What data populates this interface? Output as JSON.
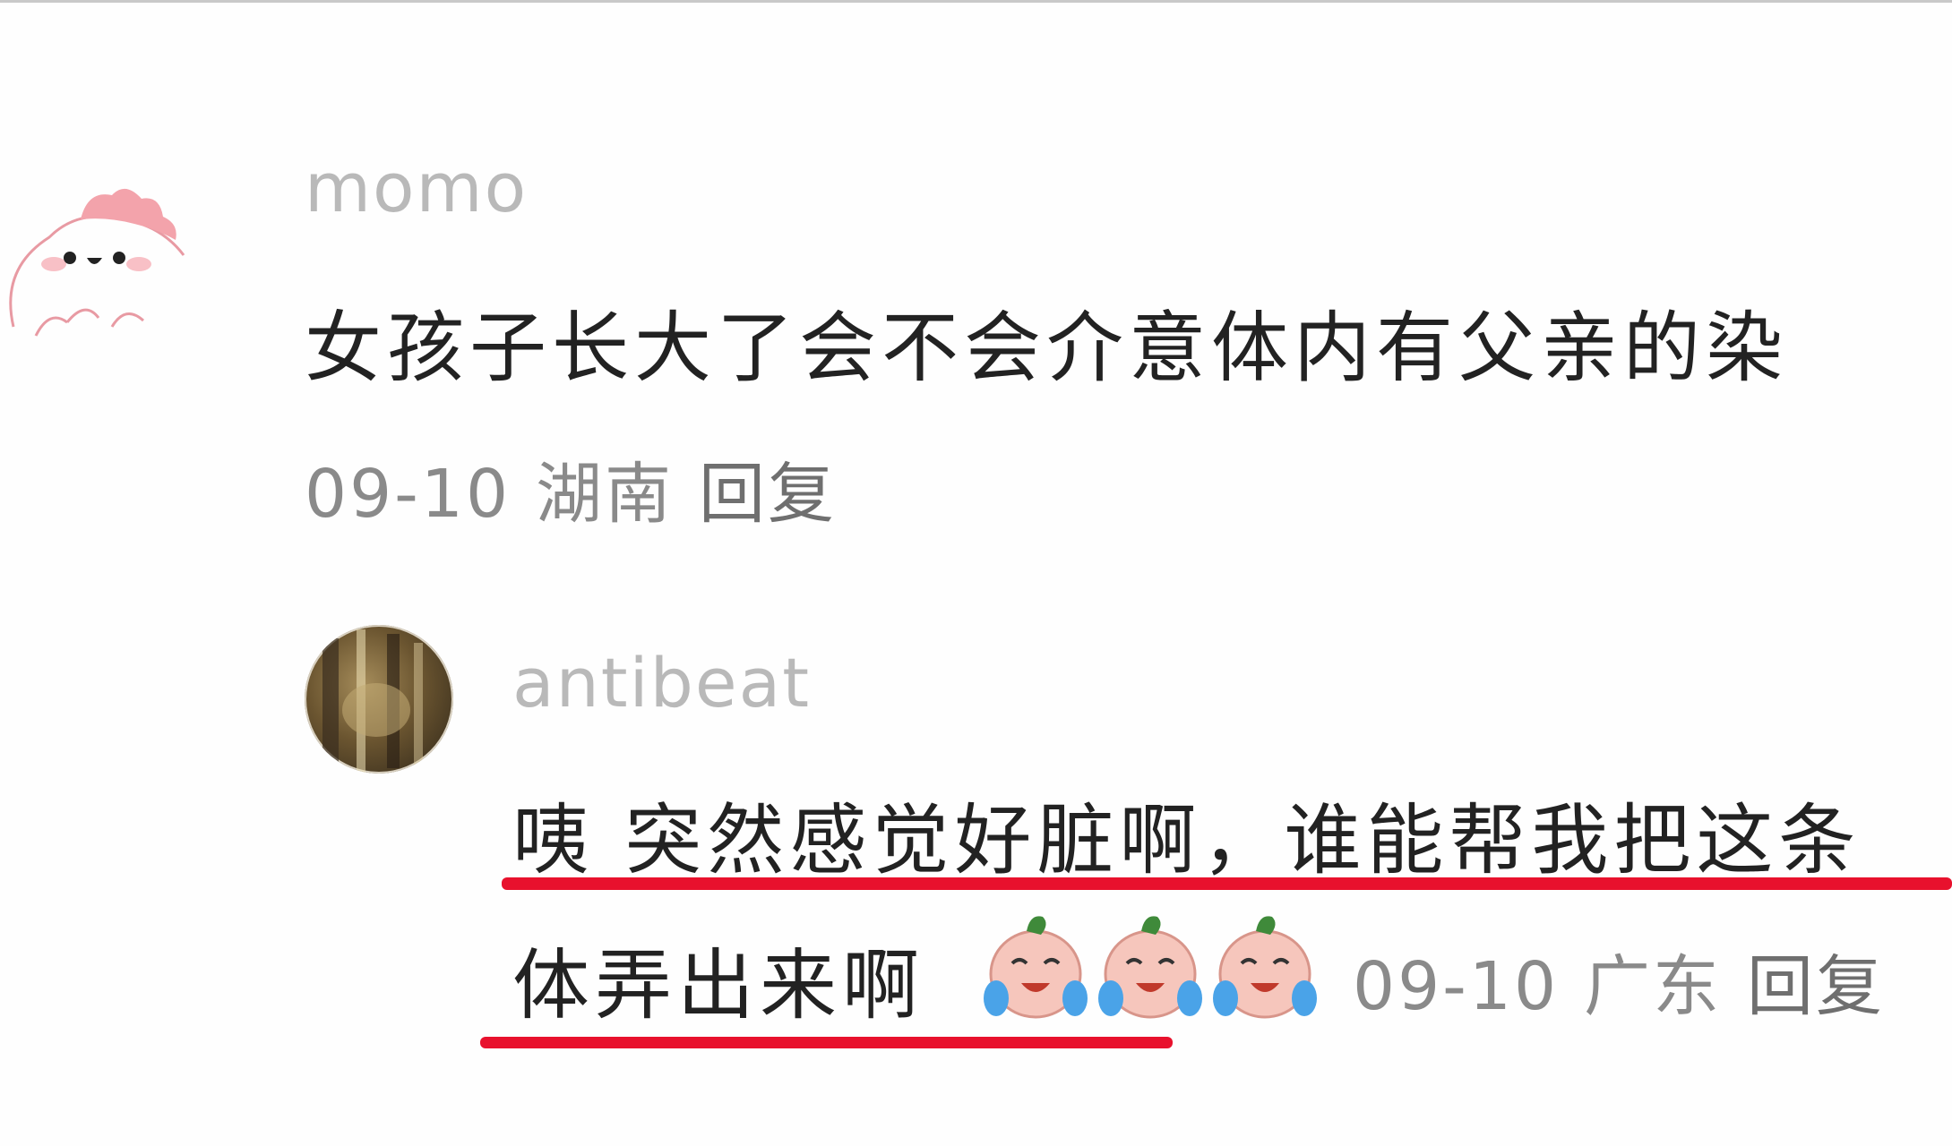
{
  "main_comment": {
    "username": "momo",
    "text": "女孩子长大了会不会介意体内有父亲的染",
    "date": "09-10",
    "location": "湖南",
    "reply_label": "回复",
    "avatar_icon": "cute-chick-avatar-icon"
  },
  "reply_comment": {
    "username": "antibeat",
    "text_line1": "咦 突然感觉好脏啊，谁能帮我把这条",
    "text_line2": "体弄出来啊",
    "emoji_icon": "crying-face-emoji-icon",
    "emoji_count": 3,
    "date": "09-10",
    "location": "广东",
    "reply_label": "回复",
    "avatar_icon": "photo-avatar-icon"
  },
  "colors": {
    "highlight_underline": "#e8112d",
    "username_gray": "#b9b9b9",
    "meta_gray": "#8a8a8a",
    "text": "#222222"
  }
}
